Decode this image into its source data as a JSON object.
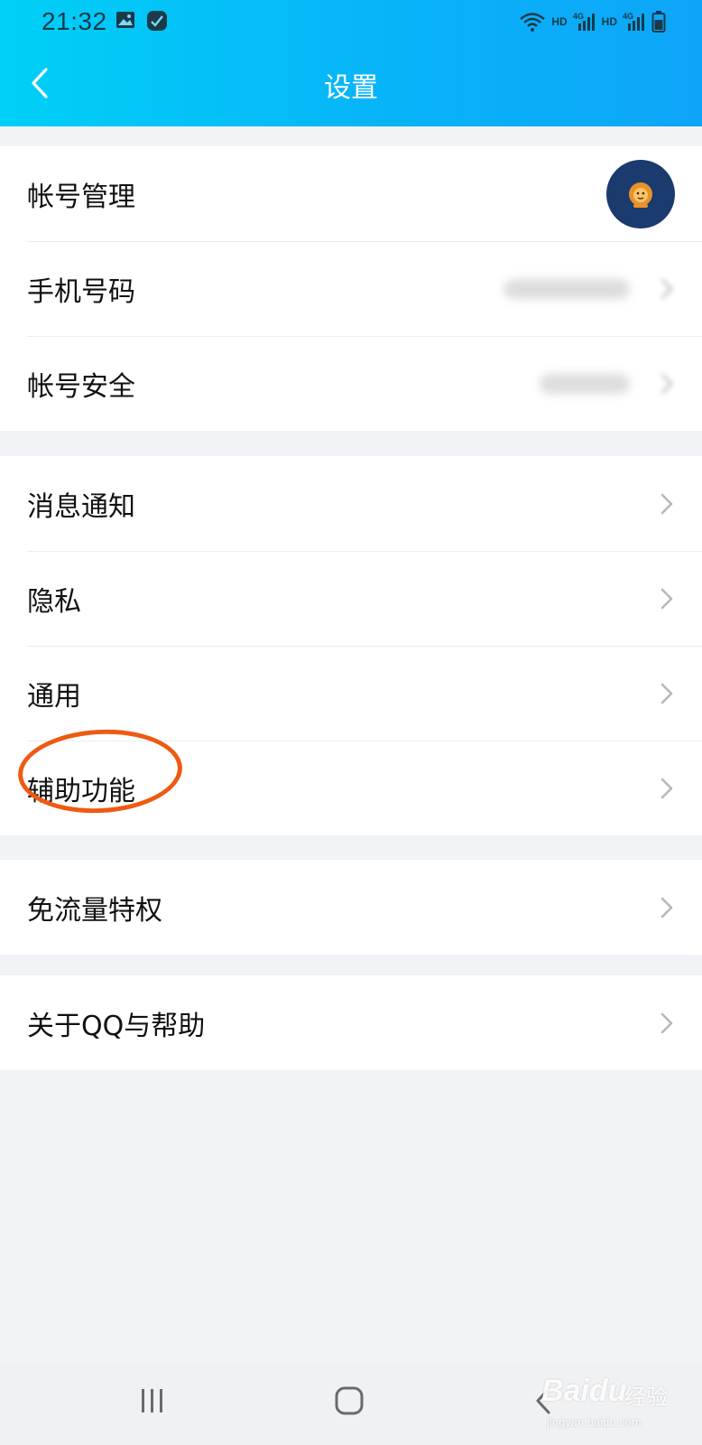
{
  "status_bar": {
    "time": "21:32",
    "hd_1": "HD",
    "hd_2": "HD",
    "net_1": "4G",
    "net_2": "4G"
  },
  "nav": {
    "title": "设置"
  },
  "groups": [
    {
      "items": [
        {
          "label": "帐号管理"
        },
        {
          "label": "手机号码"
        },
        {
          "label": "帐号安全"
        }
      ]
    },
    {
      "items": [
        {
          "label": "消息通知"
        },
        {
          "label": "隐私"
        },
        {
          "label": "通用"
        },
        {
          "label": "辅助功能"
        }
      ]
    },
    {
      "items": [
        {
          "label": "免流量特权"
        }
      ]
    },
    {
      "items": [
        {
          "label": "关于QQ与帮助"
        }
      ]
    }
  ],
  "watermark": {
    "brand": "Baidu",
    "product": "经验",
    "url": "jingyan.baidu.com"
  },
  "colors": {
    "header_start": "#00d0f7",
    "header_end": "#0ea5f8",
    "highlight": "#ee5a12",
    "avatar_bg": "#1b3a6e"
  }
}
